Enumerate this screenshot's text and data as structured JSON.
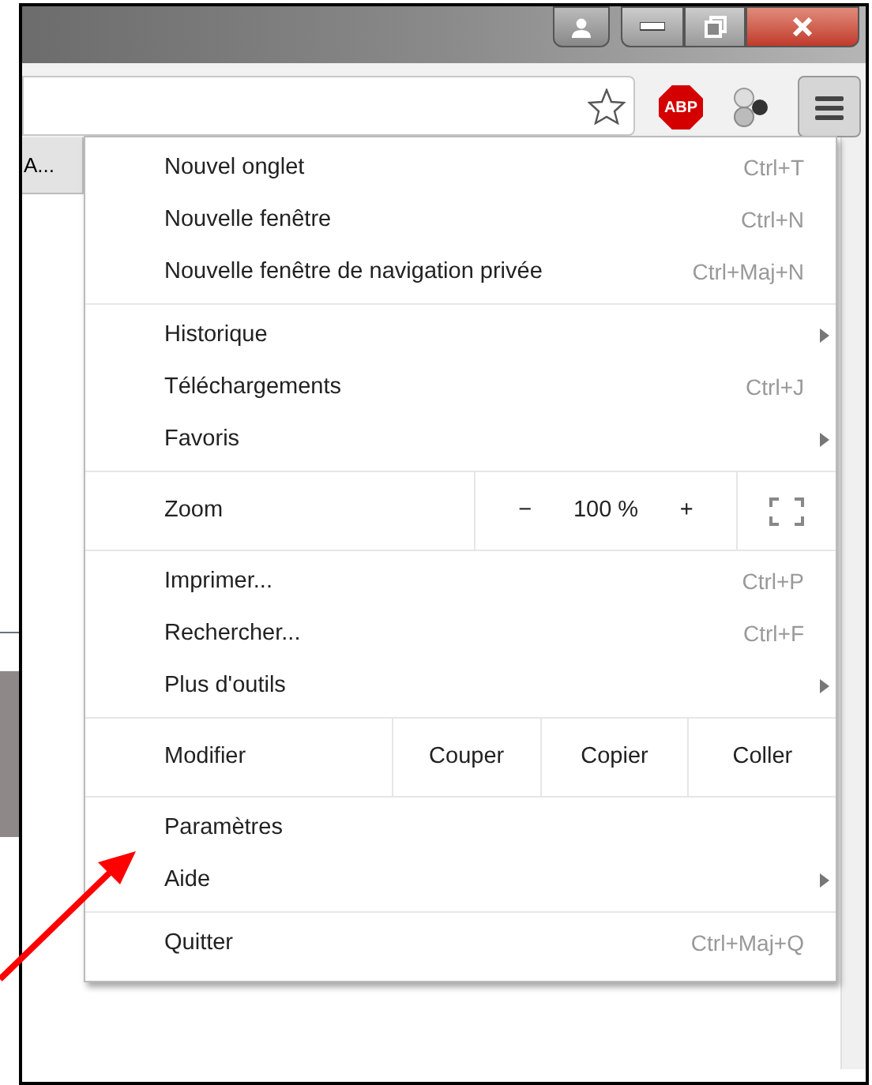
{
  "toolbar": {
    "tab_label": "A...",
    "abp_label": "ABP",
    "menu_open": true
  },
  "menu": {
    "sections": [
      {
        "kind": "items",
        "items": [
          {
            "label": "Nouvel onglet",
            "shortcut": "Ctrl+T"
          },
          {
            "label": "Nouvelle fenêtre",
            "shortcut": "Ctrl+N"
          },
          {
            "label": "Nouvelle fenêtre de navigation privée",
            "shortcut": "Ctrl+Maj+N"
          }
        ]
      },
      {
        "kind": "items",
        "items": [
          {
            "label": "Historique",
            "submenu": true
          },
          {
            "label": "Téléchargements",
            "shortcut": "Ctrl+J"
          },
          {
            "label": "Favoris",
            "submenu": true
          }
        ]
      },
      {
        "kind": "zoom",
        "label": "Zoom",
        "minus": "−",
        "value": "100 %",
        "plus": "+"
      },
      {
        "kind": "items",
        "items": [
          {
            "label": "Imprimer...",
            "shortcut": "Ctrl+P"
          },
          {
            "label": "Rechercher...",
            "shortcut": "Ctrl+F"
          },
          {
            "label": "Plus d'outils",
            "submenu": true
          }
        ]
      },
      {
        "kind": "edit",
        "label": "Modifier",
        "buttons": [
          "Couper",
          "Copier",
          "Coller"
        ]
      },
      {
        "kind": "items",
        "items": [
          {
            "label": "Paramètres"
          },
          {
            "label": "Aide",
            "submenu": true
          }
        ]
      },
      {
        "kind": "items",
        "items": [
          {
            "label": "Quitter",
            "shortcut": "Ctrl+Maj+Q"
          }
        ]
      }
    ]
  }
}
